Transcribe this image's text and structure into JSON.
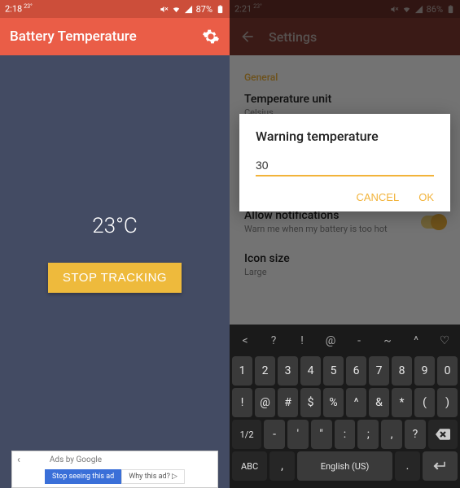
{
  "left_phone": {
    "status": {
      "time": "2:18",
      "time_sup": "23°",
      "battery_pct": "87%"
    },
    "appbar": {
      "title": "Battery Temperature"
    },
    "temperature": "23°C",
    "stop_button": "STOP TRACKING",
    "ad": {
      "header": "Ads by Google",
      "btn1": "Stop seeing this ad",
      "btn2": "Why this ad? ▷"
    }
  },
  "right_phone": {
    "status": {
      "time": "2:21",
      "time_sup": "23°",
      "battery_pct": "86%"
    },
    "appbar": {
      "title": "Settings"
    },
    "settings": {
      "section": "General",
      "items": [
        {
          "title": "Temperature unit",
          "sub": "Celsius"
        },
        {
          "title": "Allow notifications",
          "sub": "Warn me when my battery is too hot"
        },
        {
          "title": "Icon size",
          "sub": "Large"
        }
      ]
    },
    "dialog": {
      "title": "Warning temperature",
      "value": "30",
      "cancel": "CANCEL",
      "ok": "OK"
    },
    "keyboard": {
      "row0": [
        "<",
        "?",
        "!",
        "@",
        "-",
        "~",
        "^",
        "♡"
      ],
      "row1": [
        "1",
        "2",
        "3",
        "4",
        "5",
        "6",
        "7",
        "8",
        "9",
        "0"
      ],
      "row2": [
        "!",
        "@",
        "#",
        "$",
        "%",
        "^",
        "&",
        "*",
        "(",
        ")"
      ],
      "row3_first": "1/2",
      "row3": [
        "-",
        "'",
        "\"",
        ":",
        ";",
        ",",
        "?"
      ],
      "row4_abc": "ABC",
      "row4_comma": ",",
      "row4_space": "English (US)",
      "row4_dot": "."
    }
  }
}
